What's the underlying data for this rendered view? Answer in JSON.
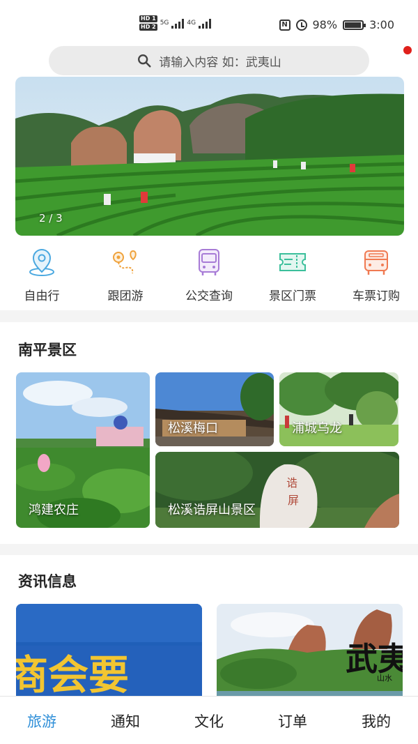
{
  "status_bar": {
    "hd1": "HD 1",
    "hd2": "HD 2",
    "net1": "5G",
    "net2": "4G",
    "nfc": "N",
    "battery": "98%",
    "time": "3:00"
  },
  "search": {
    "placeholder": "请输入内容  如：武夷山",
    "icon": "search-icon"
  },
  "banner": {
    "counter": "2 / 3"
  },
  "quick_menu": [
    {
      "label": "自由行",
      "icon": "location-pin-icon",
      "color": "#4aa8e0"
    },
    {
      "label": "跟团游",
      "icon": "route-icon",
      "color": "#f0a23c"
    },
    {
      "label": "公交查询",
      "icon": "bus-icon",
      "color": "#a77bd6"
    },
    {
      "label": "景区门票",
      "icon": "ticket-icon",
      "color": "#3bbf9b"
    },
    {
      "label": "车票订购",
      "icon": "car-ticket-icon",
      "color": "#f07a52"
    }
  ],
  "scenic": {
    "title": "南平景区",
    "tiles": [
      {
        "label": "鸿建农庄"
      },
      {
        "label": "松溪梅口"
      },
      {
        "label": "浦城乌龙"
      },
      {
        "label": "松溪诰屏山景区"
      }
    ]
  },
  "news": {
    "title": "资讯信息",
    "item1_text": "商会要",
    "item2_text": "武夷",
    "item2_sub": "山水"
  },
  "tabbar": [
    {
      "label": "旅游",
      "active": true
    },
    {
      "label": "通知",
      "active": false
    },
    {
      "label": "文化",
      "active": false
    },
    {
      "label": "订单",
      "active": false
    },
    {
      "label": "我的",
      "active": false
    }
  ],
  "colors": {
    "accent": "#2f8fd8",
    "red_dot": "#e0201b"
  }
}
